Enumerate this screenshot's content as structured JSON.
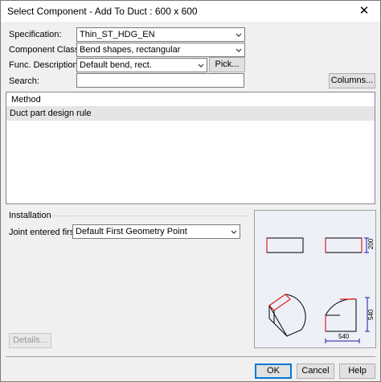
{
  "window": {
    "title": "Select Component - Add To Duct : 600 x 600",
    "close_symbol": "✕"
  },
  "form": {
    "specification": {
      "label": "Specification:",
      "value": "Thin_ST_HDG_EN"
    },
    "component_class": {
      "label": "Component Class:",
      "value": "Bend shapes, rectangular"
    },
    "func_description": {
      "label": "Func. Description:",
      "value": "Default bend, rect.",
      "pick_label": "Pick..."
    },
    "search": {
      "label": "Search:",
      "value": "",
      "columns_label": "Columns..."
    }
  },
  "list": {
    "columns": [
      "Method"
    ],
    "rows": [
      {
        "method": "Duct part design rule"
      }
    ]
  },
  "installation": {
    "group_label": "Installation",
    "joint_label": "Joint entered first:",
    "joint_value": "Default First Geometry Point",
    "details_label": "Details..."
  },
  "preview": {
    "dim_height_top": "200",
    "dim_height_side": "540",
    "dim_width_bottom": "540",
    "accent_red": "#e02020",
    "dim_blue": "#1a1aa0"
  },
  "footer": {
    "ok_label": "OK",
    "cancel_label": "Cancel",
    "help_label": "Help"
  },
  "icons": [
    "close-icon",
    "chevron-down-icon"
  ]
}
